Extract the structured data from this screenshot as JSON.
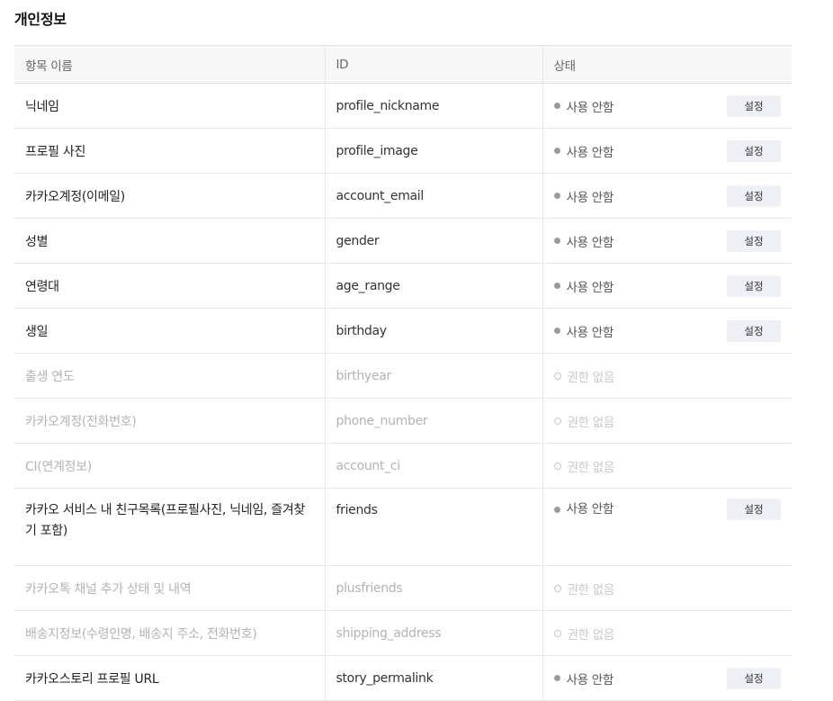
{
  "section": {
    "title": "개인정보"
  },
  "table": {
    "headers": {
      "item": "항목 이름",
      "id": "ID",
      "status": "상태"
    },
    "button_label": "설정",
    "rows": [
      {
        "name": "닉네임",
        "id": "profile_nickname",
        "status": "사용 안함",
        "enabled": true
      },
      {
        "name": "프로필 사진",
        "id": "profile_image",
        "status": "사용 안함",
        "enabled": true
      },
      {
        "name": "카카오계정(이메일)",
        "id": "account_email",
        "status": "사용 안함",
        "enabled": true
      },
      {
        "name": "성별",
        "id": "gender",
        "status": "사용 안함",
        "enabled": true
      },
      {
        "name": "연령대",
        "id": "age_range",
        "status": "사용 안함",
        "enabled": true
      },
      {
        "name": "생일",
        "id": "birthday",
        "status": "사용 안함",
        "enabled": true
      },
      {
        "name": "출생 연도",
        "id": "birthyear",
        "status": "권한 없음",
        "enabled": false
      },
      {
        "name": "카카오계정(전화번호)",
        "id": "phone_number",
        "status": "권한 없음",
        "enabled": false
      },
      {
        "name": "CI(연계정보)",
        "id": "account_ci",
        "status": "권한 없음",
        "enabled": false
      },
      {
        "name": "카카오 서비스 내 친구목록(프로필사진, 닉네임, 즐겨찾기 포함)",
        "id": "friends",
        "status": "사용 안함",
        "enabled": true
      },
      {
        "name": "카카오톡 채널 추가 상태 및 내역",
        "id": "plusfriends",
        "status": "권한 없음",
        "enabled": false
      },
      {
        "name": "배송지정보(수령인명, 배송지 주소, 전화번호)",
        "id": "shipping_address",
        "status": "권한 없음",
        "enabled": false
      },
      {
        "name": "카카오스토리 프로필 URL",
        "id": "story_permalink",
        "status": "사용 안함",
        "enabled": true
      }
    ]
  }
}
